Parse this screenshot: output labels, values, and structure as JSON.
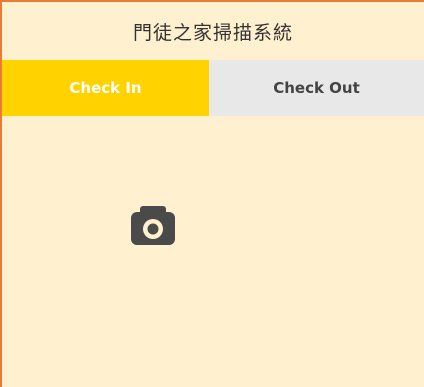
{
  "app": {
    "title": "門徒之家掃描系統"
  },
  "tabs": [
    {
      "label": "Check In",
      "active": true
    },
    {
      "label": "Check Out",
      "active": false
    }
  ],
  "main": {
    "camera_icon": "camera-icon"
  },
  "colors": {
    "background": "#fff0cf",
    "border": "#e87c35",
    "active_tab": "#ffd200",
    "inactive_tab": "#e8e8e8",
    "icon": "#4a4a4a"
  }
}
